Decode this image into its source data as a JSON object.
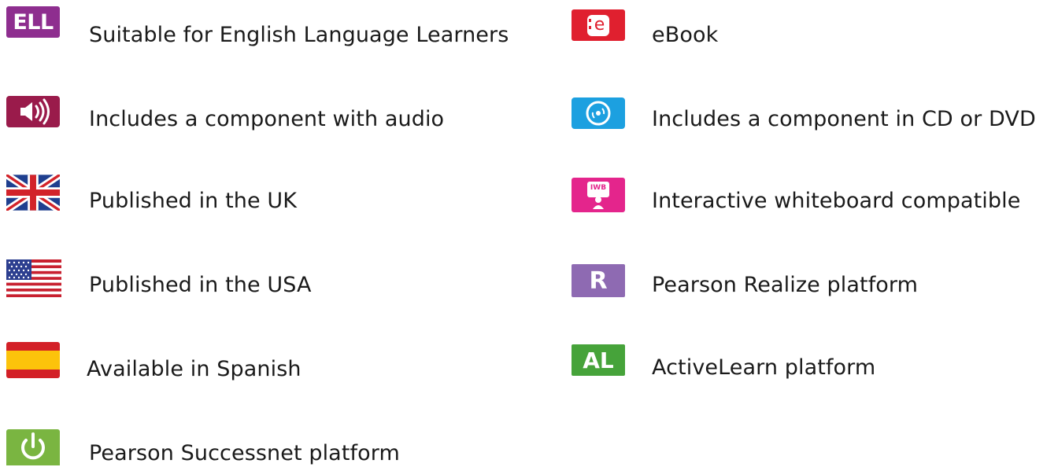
{
  "legend": {
    "left": [
      {
        "icon": "ell-icon",
        "badge": "ELL",
        "label": "Suitable for English Language Learners",
        "color": "#8e2e8f"
      },
      {
        "icon": "audio-icon",
        "label": "Includes a component with audio",
        "color": "#9a1b4b"
      },
      {
        "icon": "uk-flag-icon",
        "label": "Published in the UK"
      },
      {
        "icon": "usa-flag-icon",
        "label": "Published in the USA"
      },
      {
        "icon": "spain-flag-icon",
        "label": "Available in Spanish"
      },
      {
        "icon": "power-icon",
        "label": "Pearson Successnet platform",
        "color": "#7ab541"
      }
    ],
    "right": [
      {
        "icon": "ebook-icon",
        "badge": "e",
        "label": "eBook",
        "color": "#e0202f"
      },
      {
        "icon": "cd-dvd-icon",
        "label": "Includes a component in CD or DVD",
        "color": "#1ca0e0"
      },
      {
        "icon": "iwb-icon",
        "badge": "IWB",
        "label": "Interactive whiteboard compatible",
        "color": "#e4258c"
      },
      {
        "icon": "realize-icon",
        "badge": "R",
        "label": "Pearson Realize platform",
        "color": "#8e6ab2"
      },
      {
        "icon": "activelearn-icon",
        "badge": "AL",
        "label": "ActiveLearn platform",
        "color": "#46a33a"
      }
    ]
  }
}
